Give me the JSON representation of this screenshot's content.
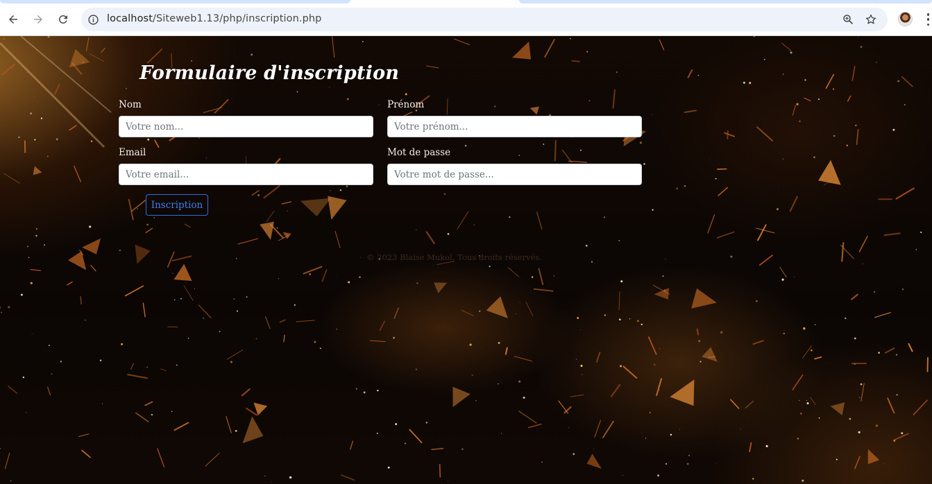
{
  "browser": {
    "url_host": "localhost",
    "url_path": "/Siteweb1.13/php/inscription.php",
    "icons": {
      "back": "arrow-left-icon",
      "forward": "arrow-right-icon",
      "reload": "reload-icon",
      "site_info": "info-icon",
      "zoom": "zoom-icon",
      "bookmark": "star-icon",
      "profile": "avatar",
      "menu": "kebab-menu-icon"
    }
  },
  "form": {
    "title": "Formulaire d'inscription",
    "fields": {
      "nom": {
        "label": "Nom",
        "placeholder": "Votre nom..."
      },
      "prenom": {
        "label": "Prénom",
        "placeholder": "Votre prénom..."
      },
      "email": {
        "label": "Email",
        "placeholder": "Votre email..."
      },
      "password": {
        "label": "Mot de passe",
        "placeholder": "Votre mot de passe..."
      }
    },
    "submit_label": "Inscription"
  },
  "footer": {
    "text": "© 2023 Blaise Mukol. Tous droits réservés."
  },
  "colors": {
    "button_accent": "#2f6fe0",
    "background": "#0b0604",
    "glow": "#ffaa3c"
  }
}
